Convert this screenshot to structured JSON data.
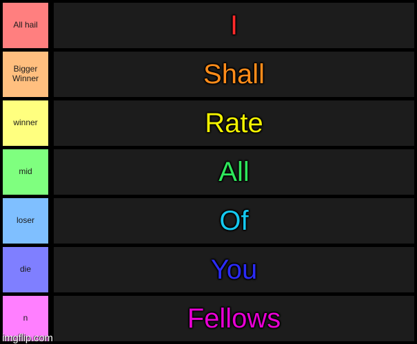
{
  "watermark": "imgflip.com",
  "background_color": "#000000",
  "row_background_color": "#1c1c1c",
  "rows": [
    {
      "label": "All hail",
      "label_color": "#ff7f7f",
      "text": "I",
      "text_color": "#ff2a2a",
      "text_size": "40px"
    },
    {
      "label": "Bigger Winner",
      "label_color": "#ffbf7f",
      "text": "Shall",
      "text_color": "#ff8c1a",
      "text_size": "40px"
    },
    {
      "label": "winner",
      "label_color": "#ffff7f",
      "text": "Rate",
      "text_color": "#f2f200",
      "text_size": "40px"
    },
    {
      "label": "mid",
      "label_color": "#7fff7f",
      "text": "All",
      "text_color": "#2ee65b",
      "text_size": "40px"
    },
    {
      "label": "loser",
      "label_color": "#7fbfff",
      "text": "Of",
      "text_color": "#14c8f0",
      "text_size": "40px"
    },
    {
      "label": "die",
      "label_color": "#7f7fff",
      "text": "You",
      "text_color": "#2b2bf5",
      "text_size": "40px"
    },
    {
      "label": "n",
      "label_color": "#ff7fff",
      "text": "Fellows",
      "text_color": "#e800d4",
      "text_size": "40px"
    }
  ]
}
